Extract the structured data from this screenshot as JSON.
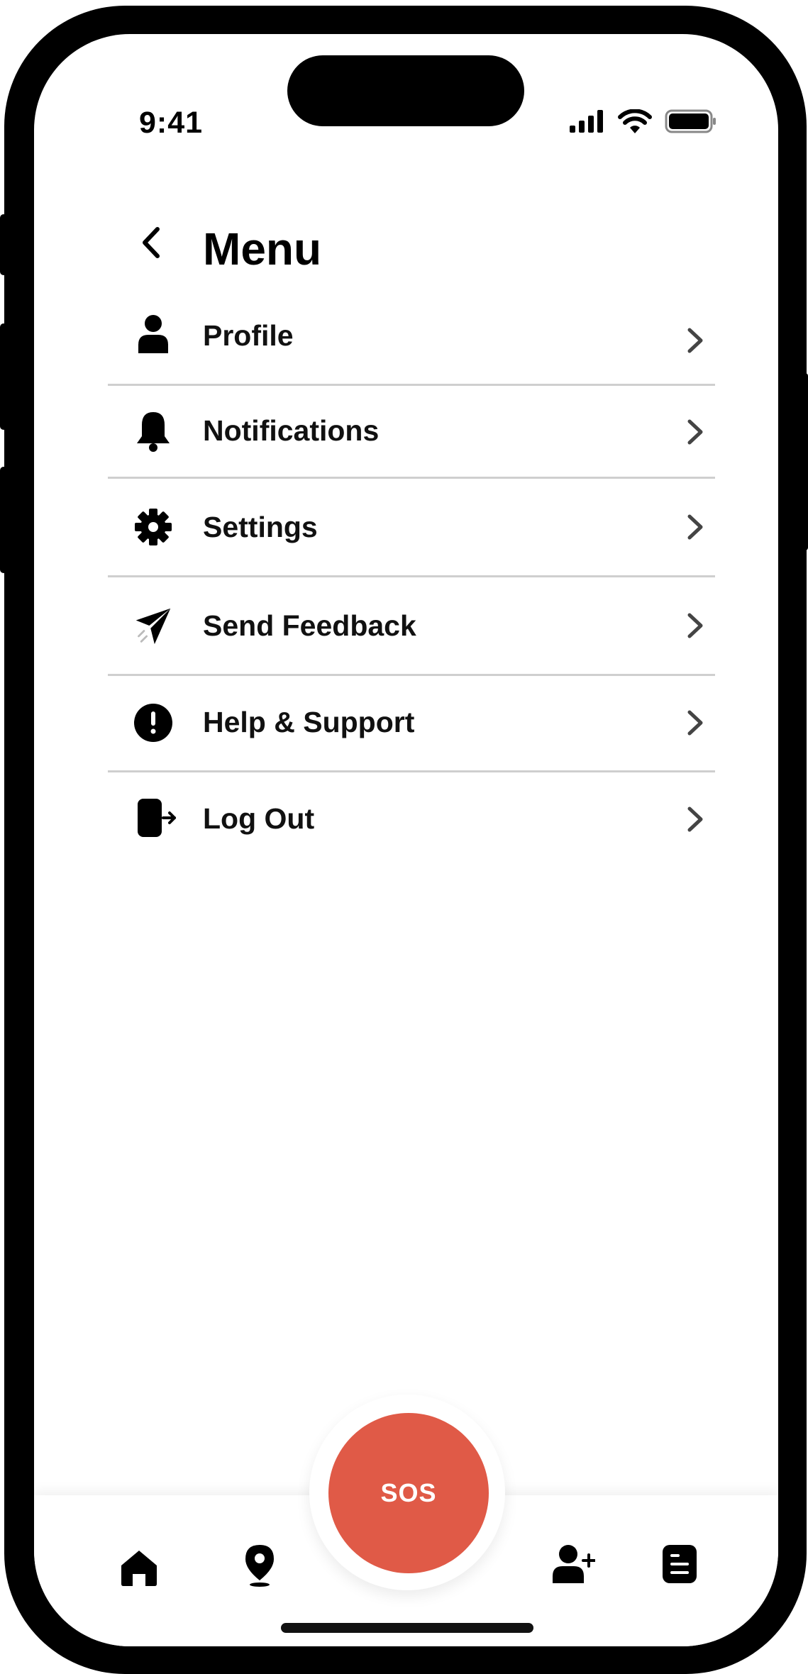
{
  "status_bar": {
    "time": "9:41",
    "icons": [
      "cellular-signal-icon",
      "wifi-icon",
      "battery-icon"
    ]
  },
  "header": {
    "back_icon": "chevron-left-icon",
    "title": "Menu"
  },
  "menu": {
    "items": [
      {
        "label": "Profile",
        "icon": "person-icon"
      },
      {
        "label": "Notifications",
        "icon": "bell-icon"
      },
      {
        "label": "Settings",
        "icon": "gear-icon"
      },
      {
        "label": "Send Feedback",
        "icon": "paper-plane-icon"
      },
      {
        "label": "Help & Support",
        "icon": "exclamation-circle-icon"
      },
      {
        "label": "Log Out",
        "icon": "logout-icon"
      }
    ]
  },
  "bottom_nav": {
    "items": [
      {
        "icon": "home-icon"
      },
      {
        "icon": "location-pin-icon"
      },
      {
        "icon": "add-person-icon"
      },
      {
        "icon": "document-icon"
      }
    ],
    "sos_label": "SOS"
  },
  "colors": {
    "accent": "#e05a47",
    "text": "#111111",
    "divider": "#cfcfcf"
  }
}
